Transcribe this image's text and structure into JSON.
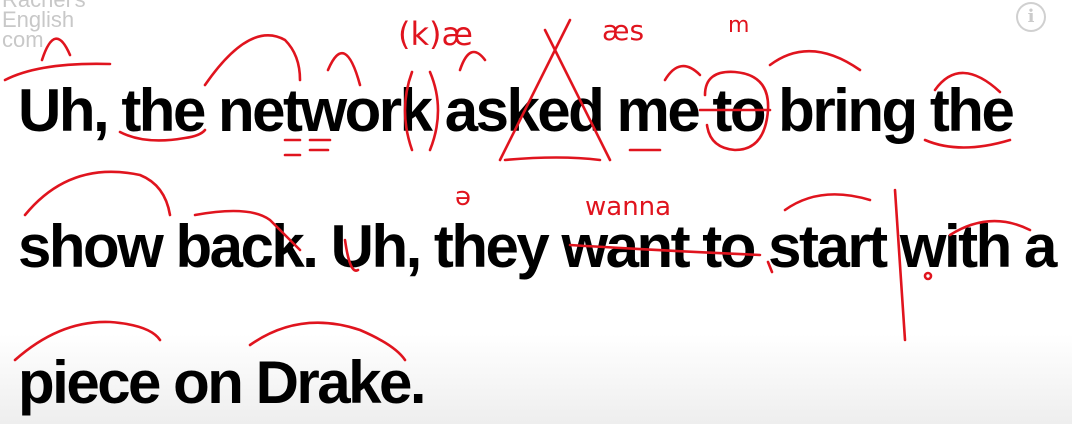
{
  "watermark": {
    "line1": "Rachel's",
    "line2": "English",
    "line3": "com"
  },
  "info_button": {
    "glyph": "i",
    "icon": "info-icon"
  },
  "captions": {
    "line1": "Uh, the network asked me to bring the",
    "line2": "show back.  Uh, they want to start with a",
    "line3": "piece on Drake."
  },
  "annotations": {
    "above_want_to": "wanna",
    "above_asked": "æs",
    "near_the_network": "(k)æ",
    "below_asked": "ə",
    "end_of_asked": "m"
  },
  "colors": {
    "ink": "#e0141e",
    "text": "#000000",
    "background": "#ffffff"
  }
}
